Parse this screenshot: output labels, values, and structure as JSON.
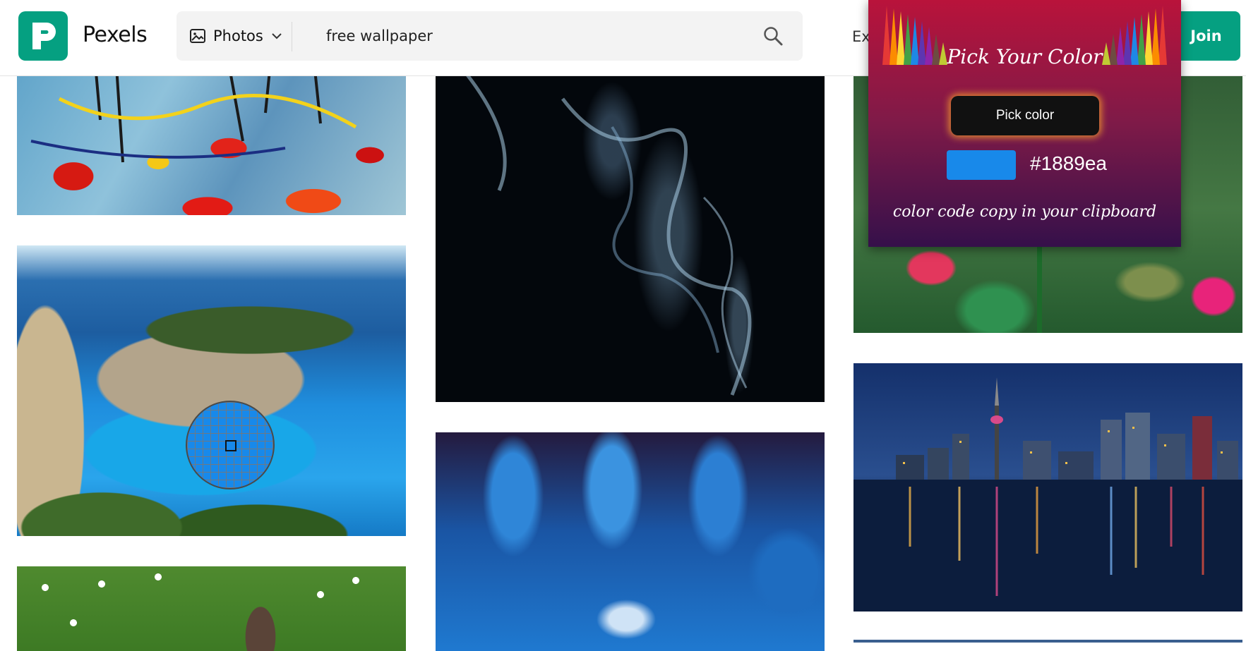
{
  "header": {
    "brand": "Pexels",
    "media_type": "Photos",
    "search_value": "free wallpaper",
    "explore_label": "Ex",
    "join_label": "Join"
  },
  "photos": [
    {
      "id": "abstract-painting"
    },
    {
      "id": "navagio-beach"
    },
    {
      "id": "rabbit-in-daisies"
    },
    {
      "id": "blue-smoke"
    },
    {
      "id": "blue-crystal"
    },
    {
      "id": "pink-flowers"
    },
    {
      "id": "toronto-skyline-night"
    }
  ],
  "picker": {
    "title": "Pick Your Color",
    "pick_button": "Pick color",
    "hex": "#1889ea",
    "message": "color code copy in your clipboard",
    "swatch_color": "#1889ea"
  },
  "colors": {
    "brand_green": "#05a081",
    "picked": "#1889ea"
  }
}
